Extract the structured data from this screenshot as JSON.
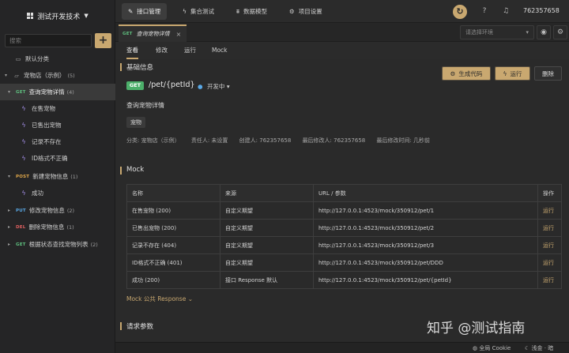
{
  "sidebar": {
    "project_name": "测试开发技术",
    "search_placeholder": "搜索",
    "add_label": "+",
    "items": [
      {
        "label": "默认分类",
        "icon": "folder-icon"
      },
      {
        "label": "宠物店（示例）",
        "count": "(5)",
        "icon": "folder-open-icon"
      },
      {
        "method": "GET",
        "label": "查询宠物详情",
        "count": "(4)"
      },
      {
        "label": "在售宠物",
        "icon": "bolt-icon"
      },
      {
        "label": "已售出宠物",
        "icon": "bolt-icon"
      },
      {
        "label": "记录不存在",
        "icon": "bolt-icon"
      },
      {
        "label": "ID格式不正确",
        "icon": "bolt-icon"
      },
      {
        "method": "POST",
        "label": "新建宠物信息",
        "count": "(1)"
      },
      {
        "label": "成功",
        "icon": "bolt-icon"
      },
      {
        "method": "PUT",
        "label": "修改宠物信息",
        "count": "(2)"
      },
      {
        "method": "DEL",
        "label": "删除宠物信息",
        "count": "(1)"
      },
      {
        "method": "GET",
        "label": "根据状态查找宠物列表",
        "count": "(2)"
      }
    ]
  },
  "topbar": {
    "tabs": [
      {
        "label": "接口管理",
        "icon": "pen-icon"
      },
      {
        "label": "集合测试",
        "icon": "bolt-icon"
      },
      {
        "label": "数据模型",
        "icon": "model-icon"
      },
      {
        "label": "项目设置",
        "icon": "gear-icon"
      }
    ],
    "user_id": "762357658"
  },
  "tabstrip": {
    "doc_tab_method": "GET",
    "doc_tab_label": "查询宠物详情",
    "close": "×",
    "env_placeholder": "请选择环境"
  },
  "subtabs": [
    "查看",
    "修改",
    "运行",
    "Mock"
  ],
  "basic": {
    "section_title": "基础信息",
    "method": "GET",
    "path": "/pet/{petId}",
    "status": "开发中",
    "description": "查询宠物详情",
    "tag": "宠物",
    "meta": {
      "category": "分类: 宠物店（示例）",
      "owner": "责任人: 未设置",
      "creator": "创建人: 762357658",
      "modifier": "最后修改人: 762357658",
      "modified_time": "最后修改时间: 几秒前"
    },
    "buttons": {
      "gen_code": "生成代码",
      "run": "运行",
      "delete": "删除"
    }
  },
  "mock": {
    "section_title": "Mock",
    "columns": [
      "名称",
      "来源",
      "URL / 参数",
      "操作"
    ],
    "rows": [
      {
        "name": "在售宠物 (200)",
        "source": "自定义期望",
        "url": "http://127.0.0.1:4523/mock/350912/pet/1",
        "op": "运行"
      },
      {
        "name": "已售出宠物 (200)",
        "source": "自定义期望",
        "url": "http://127.0.0.1:4523/mock/350912/pet/2",
        "op": "运行"
      },
      {
        "name": "记录不存在 (404)",
        "source": "自定义期望",
        "url": "http://127.0.0.1:4523/mock/350912/pet/3",
        "op": "运行"
      },
      {
        "name": "ID格式不正确 (401)",
        "source": "自定义期望",
        "url": "http://127.0.0.1:4523/mock/350912/pet/DDD",
        "op": "运行"
      },
      {
        "name": "成功 (200)",
        "source": "接口 Response 默认",
        "url": "http://127.0.0.1:4523/mock/350912/pet/{petId}",
        "op": "运行"
      }
    ],
    "public_link": "Mock 公共 Response"
  },
  "request": {
    "section_title": "请求参数"
  },
  "statusbar": {
    "cookie": "全局 Cookie",
    "theme": "浅金 · 暗"
  },
  "watermark": "知乎 @测试指南",
  "colors": {
    "accent": "#c9a870",
    "get": "#4caf6a",
    "background": "#2a2a2a"
  }
}
